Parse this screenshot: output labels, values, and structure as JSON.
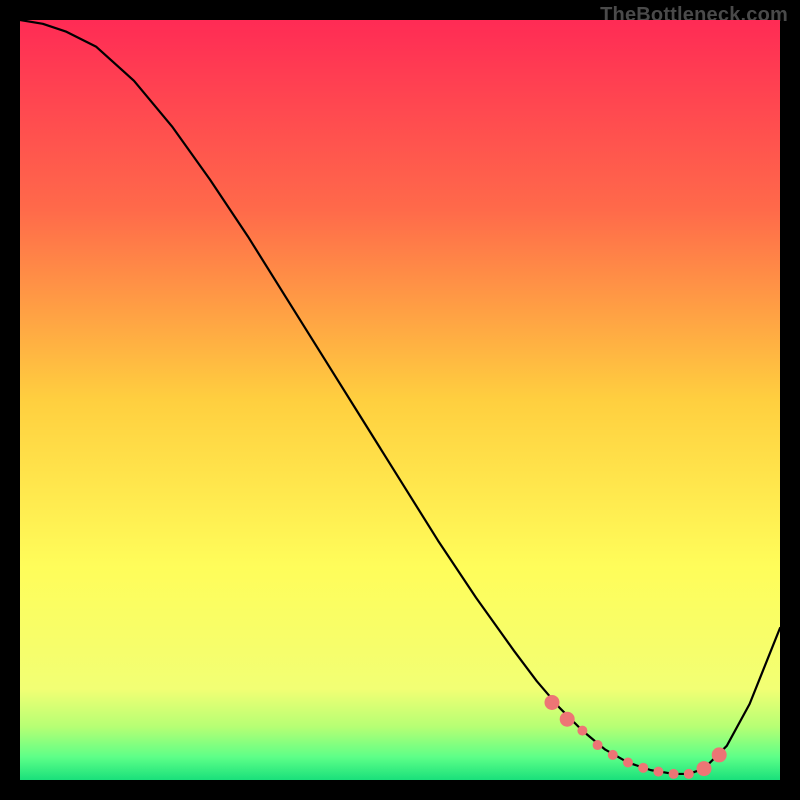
{
  "watermark": "TheBottleneck.com",
  "chart_data": {
    "type": "line",
    "title": "",
    "xlabel": "",
    "ylabel": "",
    "xlim": [
      0,
      100
    ],
    "ylim": [
      0,
      100
    ],
    "background_gradient": {
      "stops": [
        {
          "offset": 0.0,
          "color": "#ff2b55"
        },
        {
          "offset": 0.25,
          "color": "#ff6a4a"
        },
        {
          "offset": 0.5,
          "color": "#ffcf3f"
        },
        {
          "offset": 0.72,
          "color": "#fffd5a"
        },
        {
          "offset": 0.88,
          "color": "#f2ff74"
        },
        {
          "offset": 0.93,
          "color": "#b6ff74"
        },
        {
          "offset": 0.97,
          "color": "#5dff88"
        },
        {
          "offset": 1.0,
          "color": "#19e07b"
        }
      ]
    },
    "series": [
      {
        "name": "bottleneck-curve",
        "x": [
          0,
          3,
          6,
          10,
          15,
          20,
          25,
          30,
          35,
          40,
          45,
          50,
          55,
          60,
          65,
          68,
          71,
          74,
          77,
          80,
          83,
          86,
          88,
          90,
          93,
          96,
          100
        ],
        "y": [
          100,
          99.5,
          98.5,
          96.5,
          92,
          86,
          79,
          71.5,
          63.5,
          55.5,
          47.5,
          39.5,
          31.5,
          24,
          17,
          13,
          9.5,
          6.5,
          4,
          2.3,
          1.3,
          0.8,
          0.8,
          1.5,
          4.5,
          10,
          20
        ]
      }
    ],
    "highlight_points": {
      "name": "optimal-range-dots",
      "color": "#ed7575",
      "big": [
        {
          "x": 70,
          "y": 10.2
        },
        {
          "x": 72,
          "y": 8.0
        },
        {
          "x": 90,
          "y": 1.5
        },
        {
          "x": 92,
          "y": 3.3
        }
      ],
      "small": [
        {
          "x": 74,
          "y": 6.5
        },
        {
          "x": 76,
          "y": 4.6
        },
        {
          "x": 78,
          "y": 3.3
        },
        {
          "x": 80,
          "y": 2.3
        },
        {
          "x": 82,
          "y": 1.6
        },
        {
          "x": 84,
          "y": 1.1
        },
        {
          "x": 86,
          "y": 0.8
        },
        {
          "x": 88,
          "y": 0.8
        }
      ]
    }
  }
}
